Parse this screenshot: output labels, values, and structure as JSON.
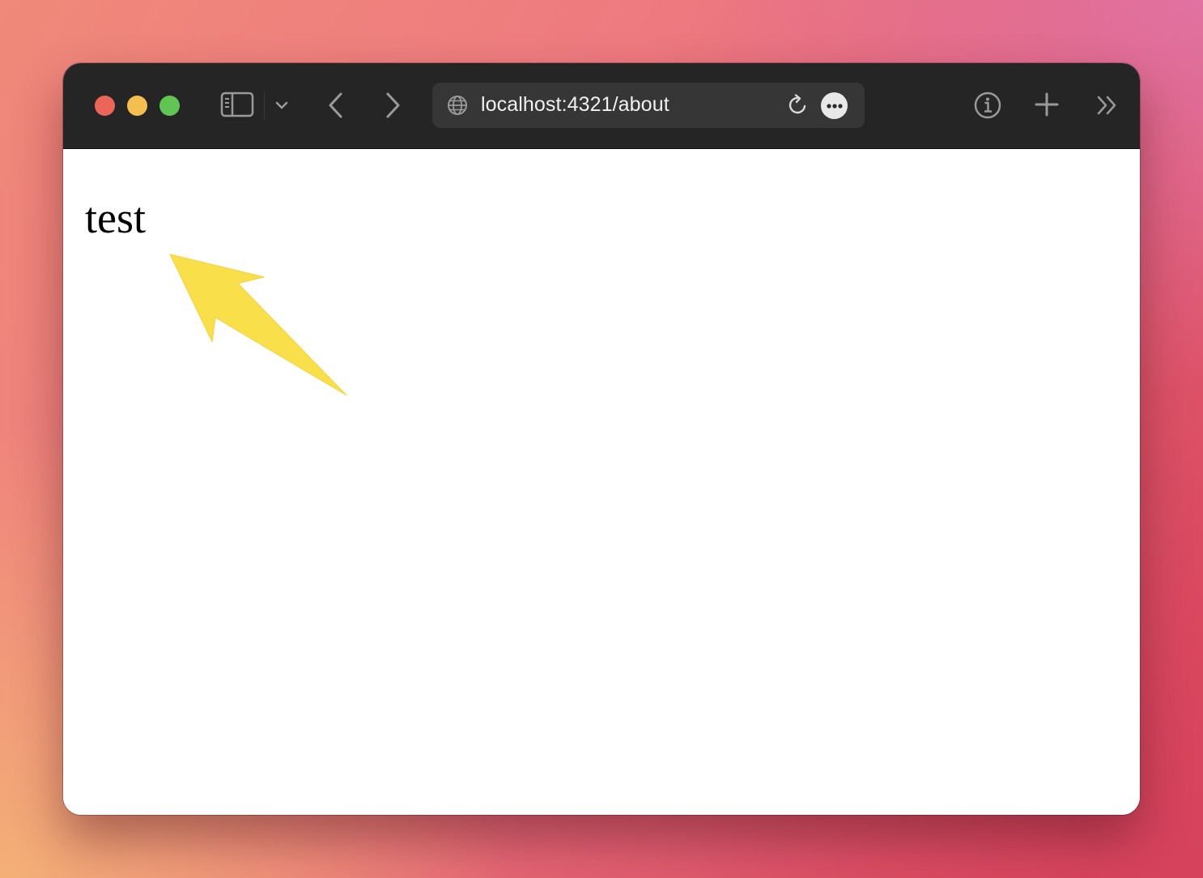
{
  "browser": {
    "address": {
      "url": "localhost:4321/about"
    },
    "icons": {
      "sidebar": "sidebar-icon",
      "sidebar_menu": "chevron-down-icon",
      "back": "chevron-left-icon",
      "forward": "chevron-right-icon",
      "site": "globe-icon",
      "reload": "reload-icon",
      "more": "ellipsis-icon",
      "info": "info-icon",
      "new_tab": "plus-icon",
      "overflow": "double-chevron-right-icon"
    },
    "colors": {
      "toolbar": "#252525",
      "address_bar": "#363636",
      "close": "#ec6559",
      "minimize": "#f4bf4f",
      "zoom": "#61c554"
    }
  },
  "page": {
    "text": "test"
  },
  "annotation": {
    "arrow_color": "#f9e04b",
    "arrow_icon": "arrow-icon"
  }
}
